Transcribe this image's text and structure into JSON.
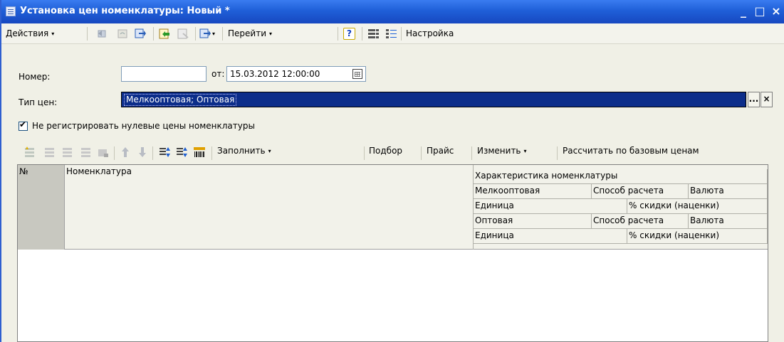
{
  "window": {
    "title": "Установка цен номенклатуры: Новый *",
    "minimize": "_",
    "maximize": "□",
    "close": "×"
  },
  "toolbar": {
    "actions": "Действия",
    "goto": "Перейти",
    "help": "?",
    "settings": "Настройка",
    "arrow": "▾"
  },
  "form": {
    "number_label": "Номер:",
    "number_value": "",
    "date_label": "от:",
    "date_value": "15.03.2012 12:00:00",
    "price_type_label": "Тип цен:",
    "price_type_value": "Мелкооптовая; Оптовая",
    "ellipsis": "...",
    "clear": "×",
    "checkbox_label": "Не регистрировать нулевые цены номенклатуры",
    "checkbox_checked": true
  },
  "table_toolbar": {
    "fill": "Заполнить",
    "pick": "Подбор",
    "price_list": "Прайс",
    "change": "Изменить",
    "calculate": "Рассчитать по базовым ценам",
    "arrow": "▾"
  },
  "grid": {
    "headers": {
      "num": "№",
      "nomenclature": "Номенклатура",
      "characteristic": "Характеристика номенклатуры",
      "row1": [
        "Мелкооптовая",
        "Способ расчета",
        "Валюта"
      ],
      "row2": [
        "Единица",
        "% скидки (наценки)"
      ],
      "row3": [
        "Оптовая",
        "Способ расчета",
        "Валюта"
      ],
      "row4": [
        "Единица",
        "% скидки (наценки)"
      ]
    },
    "rows": []
  }
}
